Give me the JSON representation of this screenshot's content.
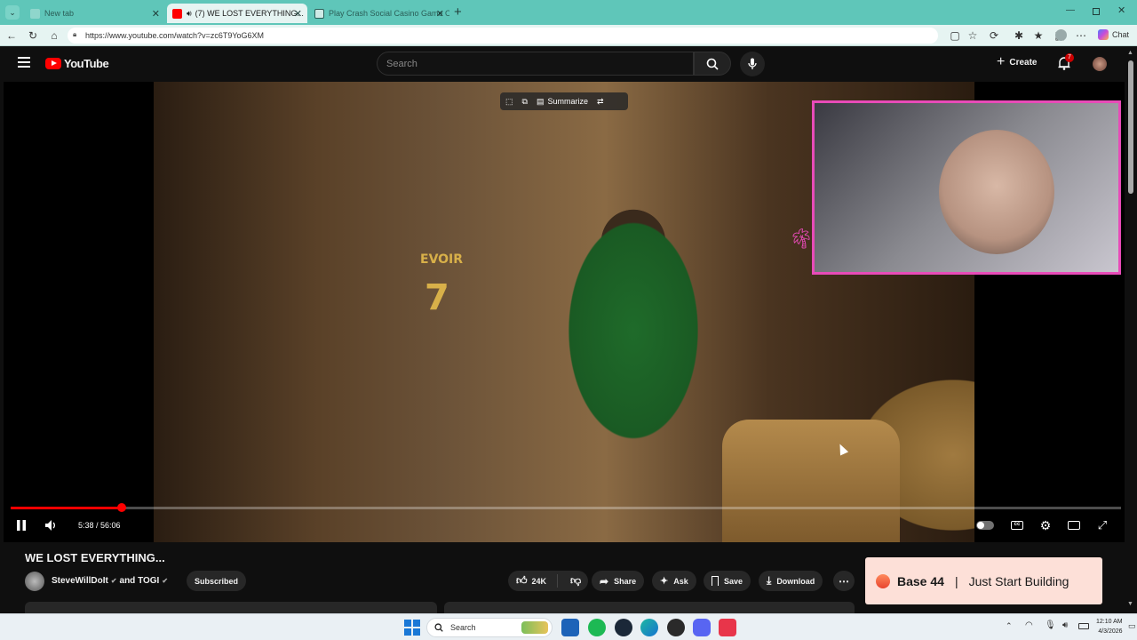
{
  "browser": {
    "tabs": [
      {
        "title": "New tab",
        "active": false
      },
      {
        "title": "(7) WE LOST EVERYTHING...",
        "active": true
      },
      {
        "title": "Play Crash Social Casino Game Or",
        "active": false
      }
    ],
    "new_tab_symbol": "+",
    "url": "https://www.youtube.com/watch?v=zc6T9YoG6XM",
    "chat_label": "Chat"
  },
  "youtube": {
    "logo_text": "YouTube",
    "search_placeholder": "Search",
    "create_label": "Create",
    "notification_count": "7"
  },
  "video": {
    "ai_tools": {
      "summarize_label": "Summarize"
    },
    "time_display": "5:38 / 56:06",
    "progress_fraction": 0.1
  },
  "details": {
    "title": "WE LOST EVERYTHING...",
    "channel": "SteveWillDoIt",
    "collab": "and TOGI",
    "subscribe_label": "Subscribed",
    "like_count": "24K",
    "share_label": "Share",
    "ask_label": "Ask",
    "save_label": "Save",
    "download_label": "Download"
  },
  "ad": {
    "brand": "Base 44",
    "separator": "|",
    "tagline": "Just Start Building"
  },
  "taskbar": {
    "search_label": "Search",
    "time": "12:10 AM",
    "date": "4/3/2026"
  },
  "colors": {
    "accent_red": "#ff0000",
    "tab_bar": "#5fc6b9",
    "pip_border": "#e84bb8"
  }
}
